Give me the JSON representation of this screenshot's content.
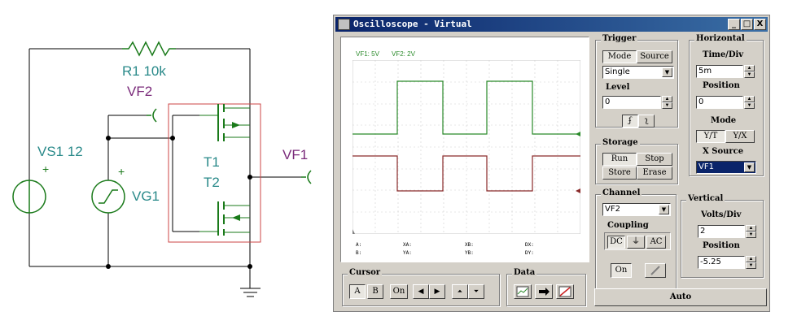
{
  "schematic": {
    "r1_label": "R1 10k",
    "vf2_label": "VF2",
    "vs1_label": "VS1 12",
    "vs1_sign": "+",
    "vg1_label": "VG1",
    "vg1_sign": "+",
    "t1_label": "T1",
    "t2_label": "T2",
    "vf1_label": "VF1",
    "colors": {
      "wire": "#000000",
      "label": "#2a8a8a",
      "probe_label": "#7a2a7a",
      "component": "#1a7a1a",
      "box": "#cc4444"
    }
  },
  "window": {
    "title": "Oscilloscope - Virtual",
    "controls": [
      "_",
      "□",
      "X"
    ]
  },
  "scope": {
    "legend_vf1": "VF1: 5V",
    "legend_vf2": "VF2: 2V",
    "readouts": {
      "a": "A:",
      "b": "B:",
      "xa": "XA:",
      "ya": "YA:",
      "xb": "XB:",
      "yb": "YB:",
      "dx": "DX:",
      "dy": "DY:"
    },
    "colors": {
      "vf1": "#2a8a2a",
      "vf2": "#8a2a2a",
      "legend": "#2a8a2a",
      "grid": "#c8c8c8"
    }
  },
  "trigger": {
    "title": "Trigger",
    "mode_label": "Mode",
    "source_label": "Source",
    "mode_value": "Single",
    "level_label": "Level",
    "level_value": "0",
    "rise_symbol": "ʄ",
    "fall_symbol": "ʅ"
  },
  "storage": {
    "title": "Storage",
    "run_label": "Run",
    "stop_label": "Stop",
    "store_label": "Store",
    "erase_label": "Erase"
  },
  "channel": {
    "title": "Channel",
    "value": "VF2",
    "coupling_label": "Coupling",
    "dc_label": "DC",
    "gnd_label": "⏚",
    "ac_label": "AC",
    "on_label": "On"
  },
  "horizontal": {
    "title": "Horizontal",
    "timediv_label": "Time/Div",
    "timediv_value": "5m",
    "position_label": "Position",
    "position_value": "0",
    "mode_label": "Mode",
    "yt_label": "Y/T",
    "yx_label": "Y/X",
    "xsource_label": "X Source",
    "xsource_value": "VF1"
  },
  "vertical": {
    "title": "Vertical",
    "voltsdiv_label": "Volts/Div",
    "voltsdiv_value": "2",
    "position_label": "Position",
    "position_value": "-5.25"
  },
  "cursor": {
    "title": "Cursor",
    "a_label": "A",
    "b_label": "B",
    "on_label": "On"
  },
  "data": {
    "title": "Data"
  },
  "auto_label": "Auto"
}
